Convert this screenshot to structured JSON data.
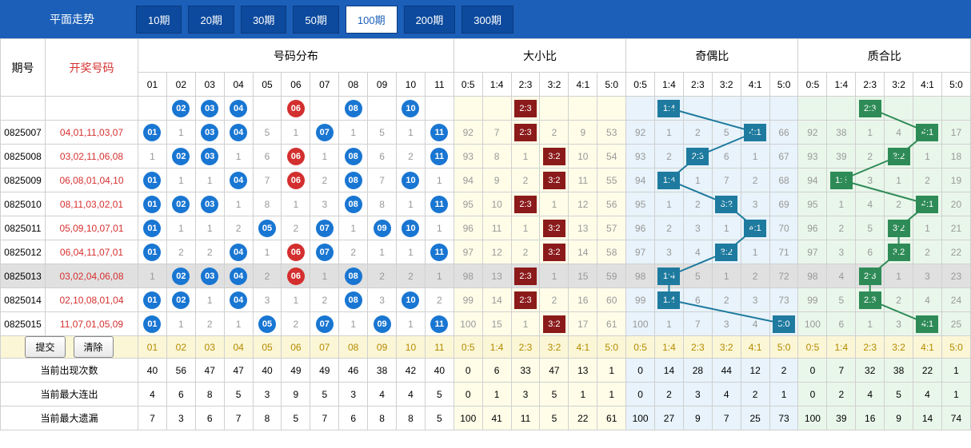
{
  "header": {
    "title": "平面走势",
    "period_tabs": [
      "10期",
      "20期",
      "30期",
      "50期",
      "100期",
      "200期",
      "300期"
    ],
    "active_tab": 4
  },
  "columns": {
    "issue": "期号",
    "nums": "开奖号码",
    "dist": "号码分布",
    "dx": "大小比",
    "qo": "奇偶比",
    "zh": "质合比",
    "num_labels": [
      "01",
      "02",
      "03",
      "04",
      "05",
      "06",
      "07",
      "08",
      "09",
      "10",
      "11"
    ],
    "ratio_labels": [
      "0:5",
      "1:4",
      "2:3",
      "3:2",
      "4:1",
      "5:0"
    ]
  },
  "buttons": {
    "submit": "提交",
    "clear": "清除"
  },
  "stats_labels": {
    "appear": "当前出现次数",
    "streak": "当前最大连出",
    "miss": "当前最大遗漏"
  },
  "chart_data": {
    "type": "table",
    "rows": [
      {
        "issue": "0825007",
        "nums": "04,01,11,03,07",
        "balls": [
          1,
          3,
          4,
          7,
          11
        ],
        "red": [],
        "num_gaps": {
          "2": 1,
          "5": 5,
          "6": 1,
          "8": 1,
          "9": 5,
          "10": 1
        },
        "dx": {
          "hit": "2:3",
          "g": {
            "0:5": 92,
            "1:4": 7,
            "3:2": 2,
            "4:1": 9,
            "5:0": 53
          }
        },
        "qo": {
          "hit": "4:1",
          "g": {
            "0:5": 92,
            "1:4": 1,
            "2:3": 2,
            "3:2": 5,
            "5:0": 66
          }
        },
        "zh": {
          "hit": "4:1",
          "g": {
            "0:5": 92,
            "1:4": 38,
            "2:3": 1,
            "3:2": 4,
            "5:0": 17
          }
        }
      },
      {
        "issue": "0825008",
        "nums": "03,02,11,06,08",
        "balls": [
          2,
          3,
          8,
          11
        ],
        "red": [
          6
        ],
        "num_gaps": {
          "1": 1,
          "4": 1,
          "5": 6,
          "7": 1,
          "9": 6,
          "10": 2
        },
        "dx": {
          "hit": "3:2",
          "g": {
            "0:5": 93,
            "1:4": 8,
            "2:3": 1,
            "4:1": 10,
            "5:0": 54
          }
        },
        "qo": {
          "hit": "2:3",
          "g": {
            "0:5": 93,
            "1:4": 2,
            "3:2": 6,
            "4:1": 1,
            "5:0": 67
          }
        },
        "zh": {
          "hit": "3:2",
          "g": {
            "0:5": 93,
            "1:4": 39,
            "2:3": 2,
            "4:1": 1,
            "5:0": 18
          }
        }
      },
      {
        "issue": "0825009",
        "nums": "06,08,01,04,10",
        "balls": [
          1,
          4,
          8,
          10
        ],
        "red": [
          6
        ],
        "num_gaps": {
          "2": 1,
          "3": 1,
          "5": 7,
          "7": 2,
          "9": 7,
          "11": 1
        },
        "dx": {
          "hit": "3:2",
          "g": {
            "0:5": 94,
            "1:4": 9,
            "2:3": 2,
            "4:1": 11,
            "5:0": 55
          }
        },
        "qo": {
          "hit": "1:4",
          "g": {
            "0:5": 94,
            "2:3": 1,
            "3:2": 7,
            "4:1": 2,
            "5:0": 68
          }
        },
        "zh": {
          "hit": "1:4",
          "g": {
            "0:5": 94,
            "2:3": 3,
            "3:2": 1,
            "4:1": 2,
            "5:0": 19
          }
        }
      },
      {
        "issue": "0825010",
        "nums": "08,11,03,02,01",
        "balls": [
          1,
          2,
          3,
          8,
          11
        ],
        "red": [],
        "num_gaps": {
          "4": 1,
          "5": 8,
          "6": 1,
          "7": 3,
          "9": 8,
          "10": 1
        },
        "dx": {
          "hit": "2:3",
          "g": {
            "0:5": 95,
            "1:4": 10,
            "3:2": 1,
            "4:1": 12,
            "5:0": 56
          }
        },
        "qo": {
          "hit": "3:2",
          "g": {
            "0:5": 95,
            "1:4": 1,
            "2:3": 2,
            "4:1": 3,
            "5:0": 69
          }
        },
        "zh": {
          "hit": "4:1",
          "g": {
            "0:5": 95,
            "1:4": 1,
            "2:3": 4,
            "3:2": 2,
            "5:0": 20
          }
        }
      },
      {
        "issue": "0825011",
        "nums": "05,09,10,07,01",
        "balls": [
          1,
          5,
          7,
          9,
          10
        ],
        "red": [],
        "num_gaps": {
          "2": 1,
          "3": 1,
          "4": 2,
          "6": 2,
          "8": 1,
          "11": 1
        },
        "dx": {
          "hit": "3:2",
          "g": {
            "0:5": 96,
            "1:4": 11,
            "2:3": 1,
            "4:1": 13,
            "5:0": 57
          }
        },
        "qo": {
          "hit": "4:1",
          "g": {
            "0:5": 96,
            "1:4": 2,
            "2:3": 3,
            "3:2": 1,
            "5:0": 70
          }
        },
        "zh": {
          "hit": "3:2",
          "g": {
            "0:5": 96,
            "1:4": 2,
            "2:3": 5,
            "4:1": 1,
            "5:0": 21
          }
        }
      },
      {
        "issue": "0825012",
        "nums": "06,04,11,07,01",
        "balls": [
          1,
          4,
          7,
          11
        ],
        "red": [
          6
        ],
        "num_gaps": {
          "2": 2,
          "3": 2,
          "5": 1,
          "8": 2,
          "9": 1,
          "10": 1
        },
        "dx": {
          "hit": "3:2",
          "g": {
            "0:5": 97,
            "1:4": 12,
            "2:3": 2,
            "4:1": 14,
            "5:0": 58
          }
        },
        "qo": {
          "hit": "3:2",
          "g": {
            "0:5": 97,
            "1:4": 3,
            "2:3": 4,
            "4:1": 1,
            "5:0": 71
          }
        },
        "zh": {
          "hit": "3:2",
          "g": {
            "0:5": 97,
            "1:4": 3,
            "2:3": 6,
            "4:1": 2,
            "5:0": 22
          }
        }
      },
      {
        "issue": "0825013",
        "nums": "03,02,04,06,08",
        "balls": [
          2,
          3,
          4,
          8
        ],
        "red": [
          6
        ],
        "num_gaps": {
          "1": 1,
          "5": 2,
          "7": 1,
          "9": 2,
          "10": 2,
          "11": 1
        },
        "dx": {
          "hit": "2:3",
          "g": {
            "0:5": 98,
            "1:4": 13,
            "3:2": 1,
            "4:1": 15,
            "5:0": 59
          }
        },
        "qo": {
          "hit": "1:4",
          "g": {
            "0:5": 98,
            "2:3": 5,
            "3:2": 1,
            "4:1": 2,
            "5:0": 72
          }
        },
        "zh": {
          "hit": "2:3",
          "g": {
            "0:5": 98,
            "1:4": 4,
            "3:2": 1,
            "4:1": 3,
            "5:0": 23
          }
        },
        "hl": true
      },
      {
        "issue": "0825014",
        "nums": "02,10,08,01,04",
        "balls": [
          1,
          2,
          4,
          8,
          10
        ],
        "red": [],
        "num_gaps": {
          "3": 1,
          "5": 3,
          "6": 1,
          "7": 2,
          "9": 3,
          "11": 2
        },
        "dx": {
          "hit": "2:3",
          "g": {
            "0:5": 99,
            "1:4": 14,
            "3:2": 2,
            "4:1": 16,
            "5:0": 60
          }
        },
        "qo": {
          "hit": "1:4",
          "g": {
            "0:5": 99,
            "2:3": 6,
            "3:2": 2,
            "4:1": 3,
            "5:0": 73
          }
        },
        "zh": {
          "hit": "2:3",
          "g": {
            "0:5": 99,
            "1:4": 5,
            "3:2": 2,
            "4:1": 4,
            "5:0": 24
          }
        }
      },
      {
        "issue": "0825015",
        "nums": "11,07,01,05,09",
        "balls": [
          1,
          5,
          7,
          9,
          11
        ],
        "red": [],
        "num_gaps": {
          "2": 1,
          "3": 2,
          "4": 1,
          "6": 2,
          "8": 1,
          "10": 1
        },
        "dx": {
          "hit": "3:2",
          "g": {
            "0:5": 100,
            "1:4": 15,
            "2:3": 1,
            "4:1": 17,
            "5:0": 61
          }
        },
        "qo": {
          "hit": "5:0",
          "g": {
            "0:5": 100,
            "1:4": 1,
            "2:3": 7,
            "3:2": 3,
            "4:1": 4
          }
        },
        "zh": {
          "hit": "4:1",
          "g": {
            "0:5": 100,
            "1:4": 6,
            "2:3": 1,
            "3:2": 3,
            "5:0": 25
          }
        }
      }
    ],
    "partial_row": {
      "dx": {
        "hit": "2:3"
      },
      "qo": {
        "hit": "1:4"
      },
      "zh": {
        "hit": "2:3"
      }
    },
    "stats": {
      "appear": {
        "num": [
          40,
          56,
          47,
          47,
          40,
          49,
          49,
          46,
          38,
          42,
          40
        ],
        "dx": [
          0,
          6,
          33,
          47,
          13,
          1
        ],
        "qo": [
          0,
          14,
          28,
          44,
          12,
          2
        ],
        "zh": [
          0,
          7,
          32,
          38,
          22,
          1
        ]
      },
      "streak": {
        "num": [
          4,
          6,
          8,
          5,
          3,
          9,
          5,
          3,
          4,
          4,
          5
        ],
        "dx": [
          0,
          1,
          3,
          5,
          1,
          1
        ],
        "qo": [
          0,
          2,
          3,
          4,
          2,
          1
        ],
        "zh": [
          0,
          2,
          4,
          5,
          4,
          1
        ]
      },
      "miss": {
        "num": [
          7,
          3,
          6,
          7,
          8,
          5,
          7,
          6,
          8,
          8,
          5
        ],
        "dx": [
          100,
          41,
          11,
          5,
          22,
          61
        ],
        "qo": [
          100,
          27,
          9,
          7,
          25,
          73
        ],
        "zh": [
          100,
          39,
          16,
          9,
          14,
          74
        ]
      }
    }
  }
}
